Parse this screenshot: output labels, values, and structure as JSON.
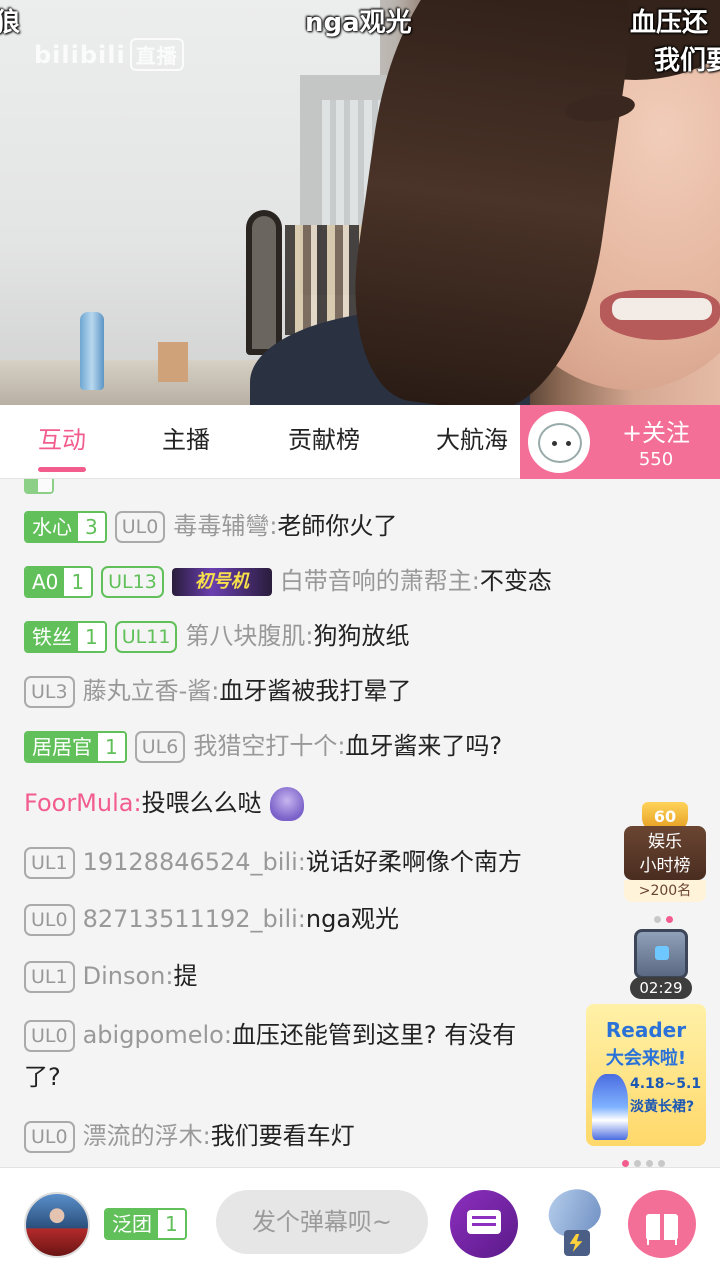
{
  "video": {
    "danmaku": [
      "狼",
      "nga观光",
      "血压还",
      "我们要"
    ],
    "logo_text": "bilibili",
    "logo_box": "直播"
  },
  "tabs": [
    {
      "label": "互动",
      "active": true
    },
    {
      "label": "主播",
      "active": false
    },
    {
      "label": "贡献榜",
      "active": false
    },
    {
      "label": "大航海",
      "active": false
    }
  ],
  "follow": {
    "label": "+关注",
    "count": "550"
  },
  "chat": {
    "partial_top": {
      "fan_name": "",
      "fan_level": "",
      "user": "",
      "text": ""
    },
    "messages": [
      {
        "fan_name": "水心",
        "fan_level": "3",
        "ul": "UL0",
        "user": "毒毒辅彎:",
        "text": "老師你火了"
      },
      {
        "fan_name": "A0",
        "fan_level": "1",
        "ul": "UL13",
        "badge": "初号机",
        "user": "白带音响的萧帮主:",
        "text": "不变态"
      },
      {
        "fan_name": "铁丝",
        "fan_level": "1",
        "ul": "UL11",
        "user": "第八块腹肌:",
        "text": "狗狗放纸"
      },
      {
        "ul": "UL3",
        "user": "藤丸立香-酱:",
        "text": "血牙酱被我打晕了"
      },
      {
        "fan_name": "居居官",
        "fan_level": "1",
        "ul": "UL6",
        "user": "我猎空打十个:",
        "text": "血牙酱来了吗?"
      },
      {
        "user": "FoorMula:",
        "text": "投喂么么哒"
      },
      {
        "ul": "UL1",
        "user": "19128846524_bili:",
        "text": "说话好柔啊像个南方"
      },
      {
        "ul": "UL0",
        "user": "82713511192_bili:",
        "text": "nga观光"
      },
      {
        "ul": "UL1",
        "user": "Dinson:",
        "text": "提"
      },
      {
        "ul": "UL0",
        "user": "abigpomelo:",
        "text": "血压还能管到这里? 有没有",
        "text2": "了?"
      },
      {
        "ul": "UL0",
        "user": "漂流的浮木:",
        "text": "我们要看车灯"
      }
    ]
  },
  "side": {
    "rank_medal": "60",
    "rank_title_1": "娱乐",
    "rank_title_2": "小时榜",
    "rank_sub": ">200名",
    "chest_timer": "02:29",
    "promo_title_1": "Reader",
    "promo_title_2": "大会来啦!",
    "promo_date": "4.18~5.1",
    "promo_sub": "淡黄长裙?"
  },
  "bottom": {
    "fan_name": "泛团",
    "fan_level": "1",
    "input_placeholder": "发个弹幕呗~"
  },
  "colors": {
    "accent": "#f25d8e",
    "fan_green": "#61c05a",
    "follow_bg": "#f46f98"
  },
  "icons": [
    "danmaku-settings-icon",
    "satellite-icon",
    "gift-icon",
    "treasure-chest-icon"
  ]
}
